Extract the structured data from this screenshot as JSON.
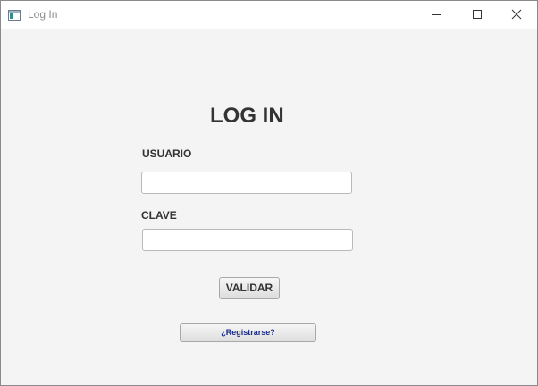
{
  "window": {
    "title": "Log In",
    "controls": {
      "minimize_icon": "minimize-icon",
      "maximize_icon": "maximize-icon",
      "close_icon": "close-icon"
    }
  },
  "form": {
    "heading": "LOG IN",
    "username_label": "USUARIO",
    "username_value": "",
    "password_label": "CLAVE",
    "password_value": "",
    "validate_label": "VALIDAR",
    "register_label": "¿Registrarse?"
  },
  "colors": {
    "background": "#f4f4f4",
    "titlebar": "#ffffff",
    "text": "#333333",
    "link_text": "#1c2a8a"
  }
}
